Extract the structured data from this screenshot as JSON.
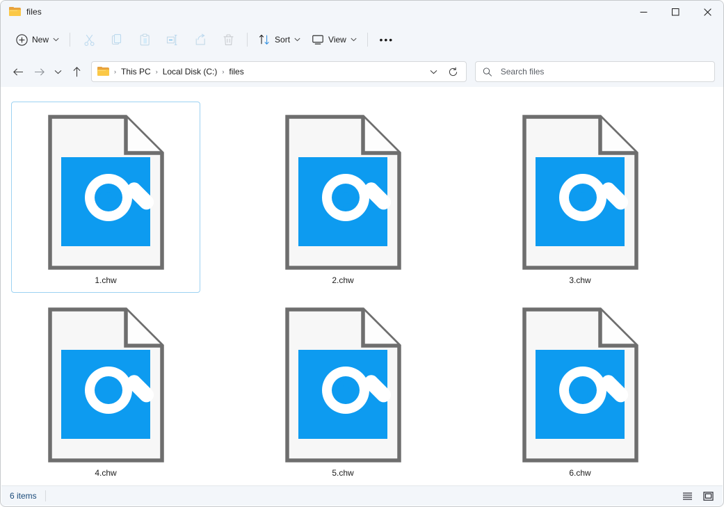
{
  "window": {
    "title": "files",
    "folder_icon": "folder-icon",
    "controls": {
      "minimize": "─",
      "maximize": "□",
      "close": "✕"
    }
  },
  "toolbar": {
    "new_label": "New",
    "new_icon": "plus-circle-icon",
    "cut_icon": "scissors-icon",
    "copy_icon": "copy-icon",
    "paste_icon": "paste-icon",
    "rename_icon": "rename-icon",
    "share_icon": "share-icon",
    "delete_icon": "trash-icon",
    "sort_label": "Sort",
    "sort_icon": "sort-arrows-icon",
    "view_label": "View",
    "view_icon": "monitor-icon",
    "more_label": "•••",
    "chevron": "⌄"
  },
  "navbar": {
    "back_icon": "arrow-left-icon",
    "forward_icon": "arrow-right-icon",
    "recent_icon": "chevron-down-icon",
    "up_icon": "arrow-up-icon",
    "breadcrumb_icon": "folder-icon",
    "breadcrumbs": [
      "This PC",
      "Local Disk (C:)",
      "files"
    ],
    "separator": "›",
    "dropdown_icon": "chevron-down-icon",
    "refresh_icon": "refresh-icon"
  },
  "search": {
    "placeholder": "Search files",
    "value": "",
    "icon": "search-icon"
  },
  "files": [
    {
      "name": "1.chw",
      "selected": true
    },
    {
      "name": "2.chw",
      "selected": false
    },
    {
      "name": "3.chw",
      "selected": false
    },
    {
      "name": "4.chw",
      "selected": false
    },
    {
      "name": "5.chw",
      "selected": false
    },
    {
      "name": "6.chw",
      "selected": false
    }
  ],
  "file_icon": {
    "type": "unknown-file-type-icon",
    "page_color": "#f7f7f7",
    "page_border": "#6e6e6e",
    "badge_color": "#0d9bf0",
    "glass_color": "#ffffff",
    "question_mark": "?"
  },
  "statusbar": {
    "items_text": "6 items",
    "details_view_icon": "list-view-icon",
    "large_icons_view_icon": "large-icons-view-icon"
  }
}
